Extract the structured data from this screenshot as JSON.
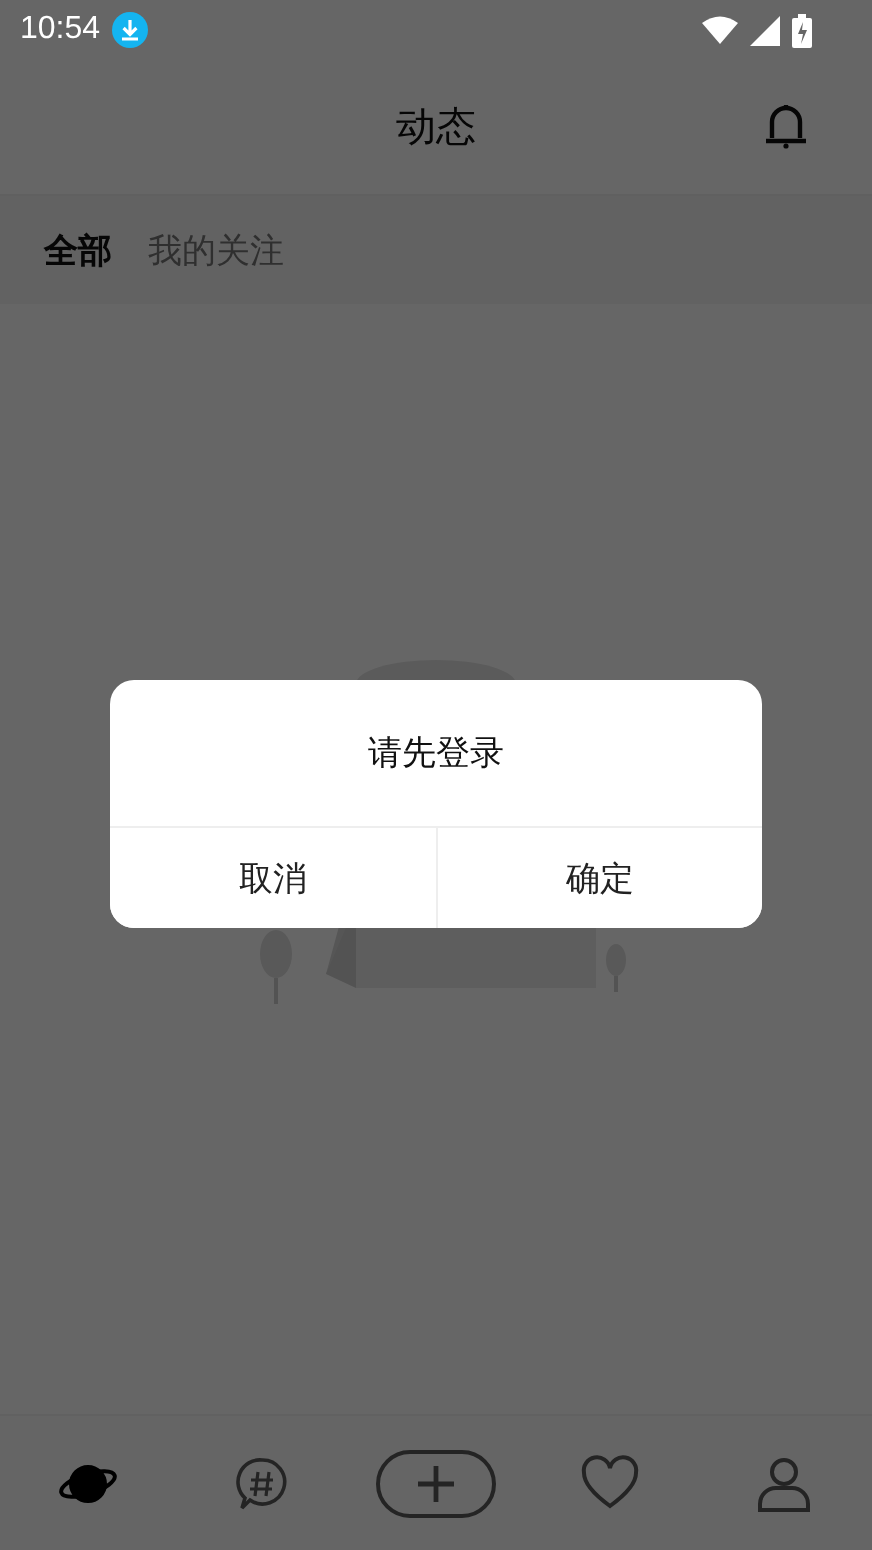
{
  "status_bar": {
    "time": "10:54"
  },
  "header": {
    "title": "动态"
  },
  "tabs": [
    {
      "label": "全部",
      "selected": true
    },
    {
      "label": "我的关注",
      "selected": false
    }
  ],
  "dialog": {
    "message": "请先登录",
    "buttons": [
      {
        "label": "取消",
        "kind": "cancel"
      },
      {
        "label": "确定",
        "kind": "confirm"
      }
    ]
  },
  "bottom_nav": [
    {
      "kind": "planet",
      "selected": true
    },
    {
      "kind": "topic",
      "selected": false
    },
    {
      "kind": "add",
      "selected": false
    },
    {
      "kind": "heart",
      "selected": false
    },
    {
      "kind": "profile",
      "selected": false
    }
  ]
}
